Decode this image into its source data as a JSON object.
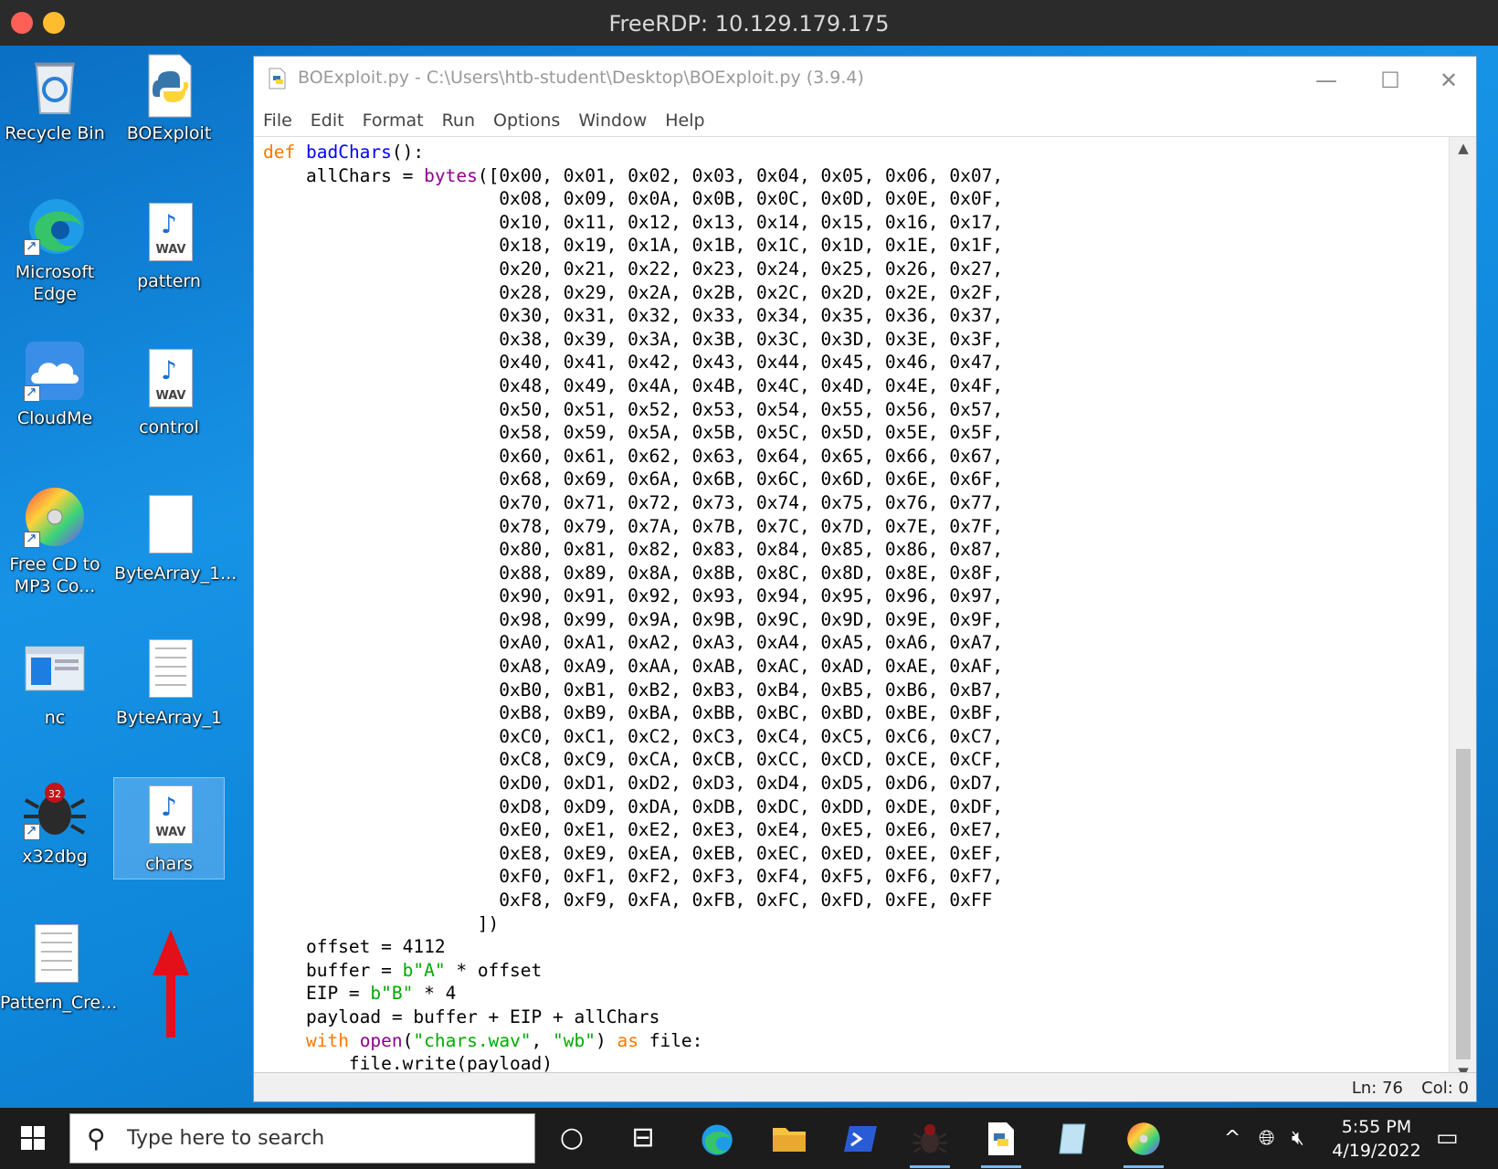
{
  "remote": {
    "title": "FreeRDP: 10.129.179.175"
  },
  "desktop_icons": [
    {
      "label": "Recycle Bin"
    },
    {
      "label": "BOExploit"
    },
    {
      "label": "Microsoft Edge"
    },
    {
      "label": "pattern"
    },
    {
      "label": "CloudMe"
    },
    {
      "label": "control"
    },
    {
      "label": "Free CD to MP3 Co..."
    },
    {
      "label": "ByteArray_1..."
    },
    {
      "label": "nc"
    },
    {
      "label": "ByteArray_1"
    },
    {
      "label": "x32dbg"
    },
    {
      "label": "chars"
    },
    {
      "label": "Pattern_Cre..."
    }
  ],
  "editor": {
    "title": "BOExploit.py - C:\\Users\\htb-student\\Desktop\\BOExploit.py (3.9.4)",
    "menu": [
      "File",
      "Edit",
      "Format",
      "Run",
      "Options",
      "Window",
      "Help"
    ],
    "func_name": "badChars",
    "var_allchars": "allChars",
    "byte_rows": [
      "0x00, 0x01, 0x02, 0x03, 0x04, 0x05, 0x06, 0x07,",
      "0x08, 0x09, 0x0A, 0x0B, 0x0C, 0x0D, 0x0E, 0x0F,",
      "0x10, 0x11, 0x12, 0x13, 0x14, 0x15, 0x16, 0x17,",
      "0x18, 0x19, 0x1A, 0x1B, 0x1C, 0x1D, 0x1E, 0x1F,",
      "0x20, 0x21, 0x22, 0x23, 0x24, 0x25, 0x26, 0x27,",
      "0x28, 0x29, 0x2A, 0x2B, 0x2C, 0x2D, 0x2E, 0x2F,",
      "0x30, 0x31, 0x32, 0x33, 0x34, 0x35, 0x36, 0x37,",
      "0x38, 0x39, 0x3A, 0x3B, 0x3C, 0x3D, 0x3E, 0x3F,",
      "0x40, 0x41, 0x42, 0x43, 0x44, 0x45, 0x46, 0x47,",
      "0x48, 0x49, 0x4A, 0x4B, 0x4C, 0x4D, 0x4E, 0x4F,",
      "0x50, 0x51, 0x52, 0x53, 0x54, 0x55, 0x56, 0x57,",
      "0x58, 0x59, 0x5A, 0x5B, 0x5C, 0x5D, 0x5E, 0x5F,",
      "0x60, 0x61, 0x62, 0x63, 0x64, 0x65, 0x66, 0x67,",
      "0x68, 0x69, 0x6A, 0x6B, 0x6C, 0x6D, 0x6E, 0x6F,",
      "0x70, 0x71, 0x72, 0x73, 0x74, 0x75, 0x76, 0x77,",
      "0x78, 0x79, 0x7A, 0x7B, 0x7C, 0x7D, 0x7E, 0x7F,",
      "0x80, 0x81, 0x82, 0x83, 0x84, 0x85, 0x86, 0x87,",
      "0x88, 0x89, 0x8A, 0x8B, 0x8C, 0x8D, 0x8E, 0x8F,",
      "0x90, 0x91, 0x92, 0x93, 0x94, 0x95, 0x96, 0x97,",
      "0x98, 0x99, 0x9A, 0x9B, 0x9C, 0x9D, 0x9E, 0x9F,",
      "0xA0, 0xA1, 0xA2, 0xA3, 0xA4, 0xA5, 0xA6, 0xA7,",
      "0xA8, 0xA9, 0xAA, 0xAB, 0xAC, 0xAD, 0xAE, 0xAF,",
      "0xB0, 0xB1, 0xB2, 0xB3, 0xB4, 0xB5, 0xB6, 0xB7,",
      "0xB8, 0xB9, 0xBA, 0xBB, 0xBC, 0xBD, 0xBE, 0xBF,",
      "0xC0, 0xC1, 0xC2, 0xC3, 0xC4, 0xC5, 0xC6, 0xC7,",
      "0xC8, 0xC9, 0xCA, 0xCB, 0xCC, 0xCD, 0xCE, 0xCF,",
      "0xD0, 0xD1, 0xD2, 0xD3, 0xD4, 0xD5, 0xD6, 0xD7,",
      "0xD8, 0xD9, 0xDA, 0xDB, 0xDC, 0xDD, 0xDE, 0xDF,",
      "0xE0, 0xE1, 0xE2, 0xE3, 0xE4, 0xE5, 0xE6, 0xE7,",
      "0xE8, 0xE9, 0xEA, 0xEB, 0xEC, 0xED, 0xEE, 0xEF,",
      "0xF0, 0xF1, 0xF2, 0xF3, 0xF4, 0xF5, 0xF6, 0xF7,",
      "0xF8, 0xF9, 0xFA, 0xFB, 0xFC, 0xFD, 0xFE, 0xFF"
    ],
    "offset_value": "4112",
    "str_a": "b\"A\"",
    "str_b": "b\"B\"",
    "eip_mult": "4",
    "payload_expr": "buffer + EIP + allChars",
    "open_file": "\"chars.wav\"",
    "open_mode": "\"wb\"",
    "write_call": "file.write(payload)",
    "status_ln": "Ln: 76",
    "status_col": "Col: 0"
  },
  "taskbar": {
    "search_placeholder": "Type here to search",
    "time": "5:55 PM",
    "date": "4/19/2022"
  },
  "colors": {
    "keyword": "#ff7700",
    "builtin": "#900090",
    "string": "#00aa00",
    "defname": "#0000ff",
    "desktop": "#0b80d8"
  }
}
